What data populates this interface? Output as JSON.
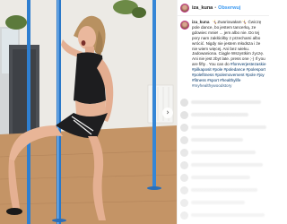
{
  "post": {
    "username": "iza_kuna",
    "separator": "•",
    "follow_label": "Obserwuj",
    "caption_user": "iza_kuna",
    "caption_text": "🤸‍♀️Zwariowałam🤸‍♀️ Ćwiczę pole dance, bo jestem tancerką, ze gdowiec mnie! ... jem albo nie. Do tej pory nam zakłóciłby z przechami albo wrócić. Nigdy nie jestem młodsza i że nie wiem więcej. Ani bez wieku. Jadowaniona. Ciągle Wszystkim życzę. Ani nie jest zbyt late. press one ;-) If you are fifty . You can do",
    "caption_tags": "#foreverjestezaskie #pilkaposit #pole #poledance #polesport #polefitness #polemovement #pole #joy #fitness #sport #healthylife #myhealthywoodstory",
    "nav_arrow": "›"
  },
  "comments": [
    {
      "width": 78
    },
    {
      "width": 64
    },
    {
      "width": 84
    },
    {
      "width": 58
    },
    {
      "width": 72
    },
    {
      "width": 80
    },
    {
      "width": 66
    },
    {
      "width": 74
    },
    {
      "width": 60
    },
    {
      "width": 82
    }
  ]
}
